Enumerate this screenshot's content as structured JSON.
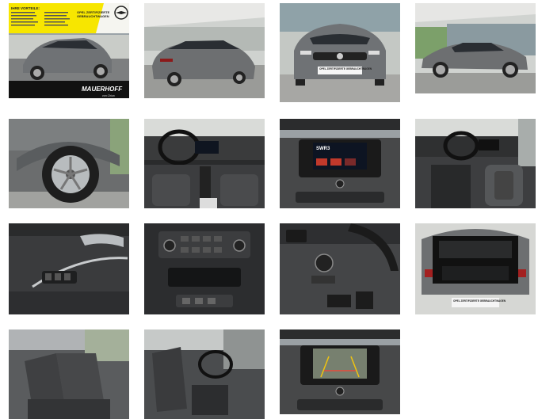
{
  "gallery": {
    "thumbnails": [
      {
        "subject": "front-three-quarter-with-dealer-banner"
      },
      {
        "subject": "rear-three-quarter"
      },
      {
        "subject": "front"
      },
      {
        "subject": "side-profile"
      },
      {
        "subject": "wheel"
      },
      {
        "subject": "dashboard"
      },
      {
        "subject": "infotainment-screen"
      },
      {
        "subject": "driver-seat-interior"
      },
      {
        "subject": "door-panel"
      },
      {
        "subject": "center-console"
      },
      {
        "subject": "light-switch-pedals"
      },
      {
        "subject": "open-trunk"
      },
      {
        "subject": "rear-seats"
      },
      {
        "subject": "front-seats"
      },
      {
        "subject": "rear-camera-display"
      }
    ]
  },
  "banner": {
    "heading": "IHRE VORTEILE:",
    "badge_line1": "OPEL ZERTIFIZIERTE",
    "badge_line2": "GEBRAUCHTWAGEN",
    "dealer": "MAUERHOFF",
    "dealer_sub": "von Chiva",
    "accent": "#f7e600"
  },
  "plates": {
    "front": "OPEL ZERTIFIZIERTE GEBRAUCHTWAGEN",
    "rear": "OPEL ZERTIFIZIERTE GEBRAUCHTWAGEN"
  },
  "screen": {
    "radio_label": "SWR3"
  }
}
